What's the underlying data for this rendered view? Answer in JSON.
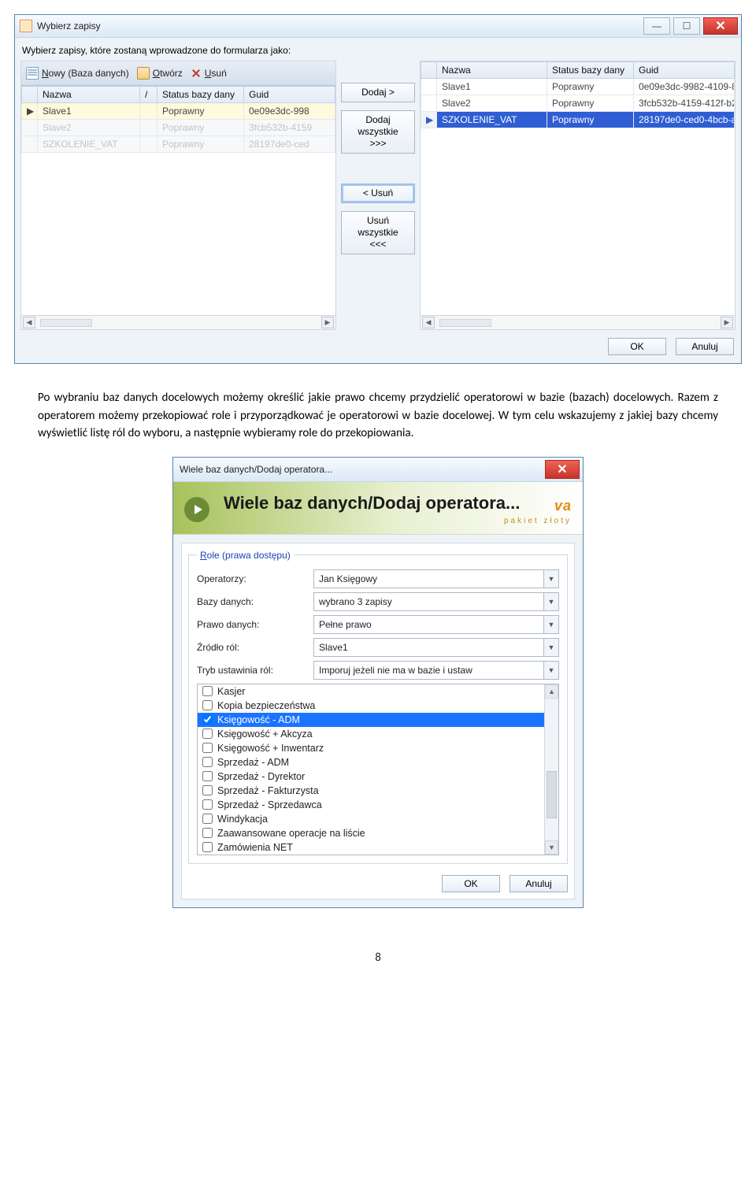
{
  "win1": {
    "title": "Wybierz zapisy",
    "instruction": "Wybierz zapisy, które zostaną wprowadzone do formularza jako:",
    "toolbar": {
      "new_label": "Nowy (Baza danych)",
      "open_label": "Otwórz",
      "delete_label": "Usuń"
    },
    "left_headers": {
      "name": "Nazwa",
      "sort": "/",
      "status": "Status bazy dany",
      "guid": "Guid"
    },
    "left_rows": [
      {
        "marker": "▶",
        "sel": "light",
        "name": "Slave1",
        "status": "Poprawny",
        "guid": "0e09e3dc-998"
      },
      {
        "marker": "",
        "sel": "inactive",
        "name": "Slave2",
        "status": "Poprawny",
        "guid": "3fcb532b-4159"
      },
      {
        "marker": "",
        "sel": "inactive",
        "name": "SZKOLENIE_VAT",
        "status": "Poprawny",
        "guid": "28197de0-ced"
      }
    ],
    "right_headers": {
      "name": "Nazwa",
      "status": "Status bazy dany",
      "guid": "Guid"
    },
    "right_rows": [
      {
        "marker": "",
        "sel": "",
        "name": "Slave1",
        "status": "Poprawny",
        "guid": "0e09e3dc-9982-4109-8"
      },
      {
        "marker": "",
        "sel": "",
        "name": "Slave2",
        "status": "Poprawny",
        "guid": "3fcb532b-4159-412f-b2"
      },
      {
        "marker": "▶",
        "sel": "blue",
        "name": "SZKOLENIE_VAT",
        "status": "Poprawny",
        "guid": "28197de0-ced0-4bcb-a"
      }
    ],
    "mid": {
      "add": "Dodaj >",
      "add_all": "Dodaj\nwszystkie\n>>>",
      "remove": "< Usuń",
      "remove_all": "Usuń\nwszystkie\n<<<"
    },
    "ok": "OK",
    "cancel": "Anuluj"
  },
  "paragraph": "Po wybraniu baz danych docelowych możemy określić jakie prawo chcemy przydzielić operatorowi w bazie (bazach) docelowych. Razem z operatorem możemy przekopiować role i przyporządkować je operatorowi w bazie docelowej. W tym celu wskazujemy z jakiej bazy chcemy wyświetlić listę ról do wyboru, a następnie wybieramy role do przekopiowania.",
  "win2": {
    "title": "Wiele baz danych/Dodaj operatora...",
    "banner_title": "Wiele baz danych/Dodaj operatora...",
    "brand": "va",
    "brand_sub": "pakiet złoty",
    "legend": "Role (prawa dostępu)",
    "fields": {
      "operator_label": "Operatorzy:",
      "operator_value": "Jan Księgowy",
      "db_label": "Bazy danych:",
      "db_value": "wybrano 3 zapisy",
      "right_label": "Prawo danych:",
      "right_value": "Pełne prawo",
      "source_label": "Źródło ról:",
      "source_value": "Slave1",
      "mode_label": "Tryb ustawinia ról:",
      "mode_value": "Imporuj jeżeli nie ma w bazie i ustaw"
    },
    "roles": [
      {
        "label": "Kasjer",
        "checked": false,
        "sel": false
      },
      {
        "label": "Kopia bezpieczeństwa",
        "checked": false,
        "sel": false
      },
      {
        "label": "Księgowość - ADM",
        "checked": true,
        "sel": true
      },
      {
        "label": "Księgowość + Akcyza",
        "checked": false,
        "sel": false
      },
      {
        "label": "Księgowość + Inwentarz",
        "checked": false,
        "sel": false
      },
      {
        "label": "Sprzedaż - ADM",
        "checked": false,
        "sel": false
      },
      {
        "label": "Sprzedaż - Dyrektor",
        "checked": false,
        "sel": false
      },
      {
        "label": "Sprzedaż - Fakturzysta",
        "checked": false,
        "sel": false
      },
      {
        "label": "Sprzedaż - Sprzedawca",
        "checked": false,
        "sel": false
      },
      {
        "label": "Windykacja",
        "checked": false,
        "sel": false
      },
      {
        "label": "Zaawansowane operacje na liście",
        "checked": false,
        "sel": false
      },
      {
        "label": "Zamówienia NET",
        "checked": false,
        "sel": false
      }
    ],
    "ok": "OK",
    "cancel": "Anuluj"
  },
  "page_number": "8"
}
